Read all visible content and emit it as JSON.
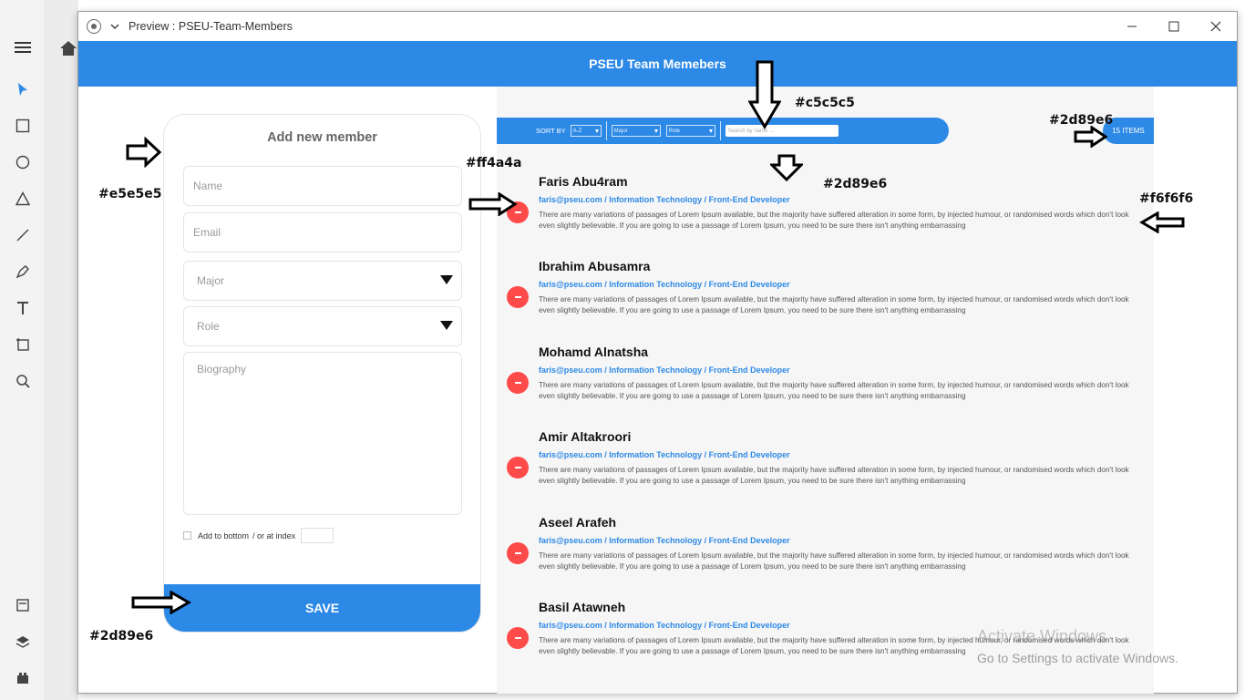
{
  "window": {
    "title": "Preview : PSEU-Team-Members"
  },
  "app": {
    "header": "PSEU Team Memebers"
  },
  "form": {
    "title": "Add new member",
    "name_placeholder": "Name",
    "email_placeholder": "Email",
    "major_placeholder": "Major",
    "role_placeholder": "Role",
    "bio_placeholder": "Biography",
    "add_bottom_label": "Add to bottom",
    "at_index_label": "/ or at index",
    "save_label": "SAVE"
  },
  "filters": {
    "sort_label": "SORT BY",
    "sort_value": "A-Z",
    "major_value": "Major",
    "role_value": "Role",
    "search_placeholder": "Search by name ...",
    "items_count": "15 ITEMS"
  },
  "members": [
    {
      "name": "Faris Abu4ram",
      "meta": "faris@pseu.com / Information Technology / Front-End Developer",
      "bio": "There are many variations of passages of Lorem Ipsum available, but the majority have suffered alteration in some form, by injected humour, or randomised words which don't look even slightly believable. If you are going to use a passage of Lorem Ipsum, you need to be sure there isn't anything embarrassing"
    },
    {
      "name": "Ibrahim Abusamra",
      "meta": "faris@pseu.com / Information Technology / Front-End Developer",
      "bio": "There are many variations of passages of Lorem Ipsum available, but the majority have suffered alteration in some form, by injected humour, or randomised words which don't look even slightly believable. If you are going to use a passage of Lorem Ipsum, you need to be sure there isn't anything embarrassing"
    },
    {
      "name": "Mohamd Alnatsha",
      "meta": "faris@pseu.com / Information Technology / Front-End Developer",
      "bio": "There are many variations of passages of Lorem Ipsum available, but the majority have suffered alteration in some form, by injected humour, or randomised words which don't look even slightly believable. If you are going to use a passage of Lorem Ipsum, you need to be sure there isn't anything embarrassing"
    },
    {
      "name": "Amir Altakroori",
      "meta": "faris@pseu.com / Information Technology / Front-End Developer",
      "bio": "There are many variations of passages of Lorem Ipsum available, but the majority have suffered alteration in some form, by injected humour, or randomised words which don't look even slightly believable. If you are going to use a passage of Lorem Ipsum, you need to be sure there isn't anything embarrassing"
    },
    {
      "name": "Aseel Arafeh",
      "meta": "faris@pseu.com / Information Technology / Front-End Developer",
      "bio": "There are many variations of passages of Lorem Ipsum available, but the majority have suffered alteration in some form, by injected humour, or randomised words which don't look even slightly believable. If you are going to use a passage of Lorem Ipsum, you need to be sure there isn't anything embarrassing"
    },
    {
      "name": "Basil Atawneh",
      "meta": "faris@pseu.com / Information Technology / Front-End Developer",
      "bio": "There are many variations of passages of Lorem Ipsum available, but the majority have suffered alteration in some form, by injected humour, or randomised words which don't look even slightly believable. If you are going to use a passage of Lorem Ipsum, you need to be sure there isn't anything embarrassing"
    }
  ],
  "annotations": {
    "form_border": "#e5e5e5",
    "save_bg": "#2d89e6",
    "remove_btn": "#ff4a4a",
    "search_text": "#c5c5c5",
    "meta_color": "#2d89e6",
    "badge_bg": "#2d89e6",
    "list_bg": "#f6f6f6"
  },
  "watermark": {
    "line1": "Activate Windows",
    "line2": "Go to Settings to activate Windows."
  },
  "colors": {
    "accent": "#2d89e6",
    "danger": "#ff4a4a",
    "border": "#e5e5e5",
    "panel": "#f6f6f6",
    "search": "#c5c5c5"
  }
}
